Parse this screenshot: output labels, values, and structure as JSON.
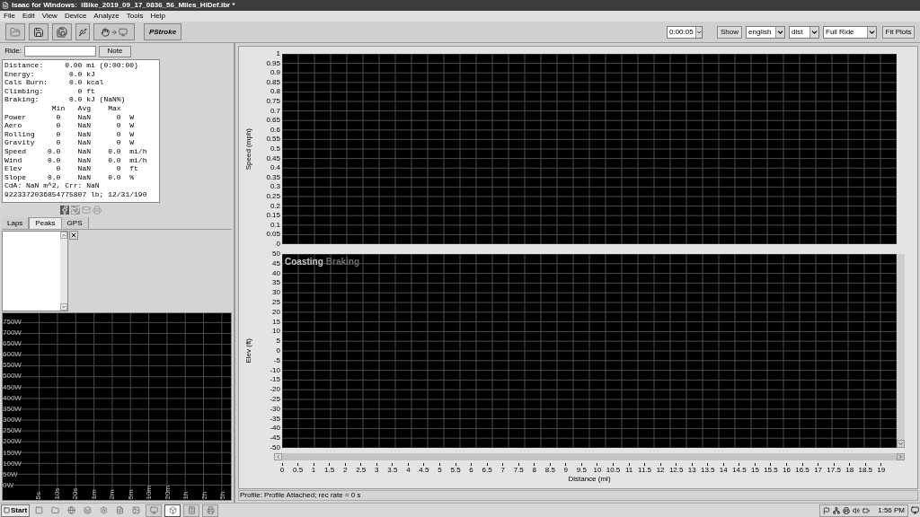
{
  "window": {
    "title": "Isaac for Windows:  iBike_2019_09_17_0836_56_Miles_HiDef.ibr *"
  },
  "menu": [
    "File",
    "Edit",
    "View",
    "Device",
    "Analyze",
    "Tools",
    "Help"
  ],
  "toolbar": {
    "logo": "PStroke",
    "interval": "0:00:05",
    "show_button": "Show",
    "units": "english",
    "axis": "dist",
    "range": "Full Ride",
    "fit_button": "Fit Plots"
  },
  "ride": {
    "label": "Ride:",
    "note_button": "Note"
  },
  "summary_lines": [
    "Distance:     0.00 mi (0:00:00)",
    "Energy:        0.0 kJ",
    "Cals Burn:     0.0 kcal",
    "Climbing:        0 ft",
    "Braking:       0.0 kJ (NaN%)",
    "           Min   Avg    Max",
    "Power       0    NaN      0  W",
    "Aero        0    NaN      0  W",
    "Rolling     0    NaN      0  W",
    "Gravity     0    NaN      0  W",
    "Speed     0.0    NaN    0.0  mi/h",
    "Wind      0.0    NaN    0.0  mi/h",
    "Elev        0    NaN      0  ft",
    "Slope     0.0    NaN    0.0  %",
    "CdA: NaN m^2, Crr: NaN",
    "9223372036854775807 lb; 12/31/190"
  ],
  "tabs": [
    {
      "label": "Laps",
      "selected": false
    },
    {
      "label": "Peaks",
      "selected": true
    },
    {
      "label": "GPS",
      "selected": false
    }
  ],
  "power_chart": {
    "y_labels": [
      "750W",
      "700W",
      "650W",
      "600W",
      "550W",
      "500W",
      "450W",
      "400W",
      "350W",
      "300W",
      "250W",
      "200W",
      "150W",
      "100W",
      "50W",
      "0W"
    ],
    "x_labels": [
      "5s",
      "10s",
      "20s",
      "1m",
      "2m",
      "5m",
      "10m",
      "20m",
      "1h",
      "2h",
      "5h"
    ]
  },
  "speed_chart": {
    "ylabel": "Speed (mph)",
    "y_labels": [
      "1",
      "0.95",
      "0.9",
      "0.85",
      "0.8",
      "0.75",
      "0.7",
      "0.65",
      "0.6",
      "0.55",
      "0.5",
      "0.45",
      "0.4",
      "0.35",
      "0.3",
      "0.25",
      "0.2",
      "0.15",
      "0.1",
      "0.05",
      "0"
    ]
  },
  "elev_chart": {
    "ylabel": "Elev (ft)",
    "legend": [
      {
        "label": "Coasting",
        "color": "#c8c8c8"
      },
      {
        "label": "Braking",
        "color": "#6a6a6a"
      }
    ],
    "y_labels": [
      "50",
      "45",
      "40",
      "35",
      "30",
      "25",
      "20",
      "15",
      "10",
      "5",
      "0",
      "-5",
      "-10",
      "-15",
      "-20",
      "-25",
      "-30",
      "-35",
      "-40",
      "-45",
      "-50"
    ]
  },
  "x_axis": {
    "label": "Distance (mi)",
    "ticks": [
      "0",
      "0.5",
      "1",
      "1.5",
      "2",
      "2.5",
      "3",
      "3.5",
      "4",
      "4.5",
      "5",
      "5.5",
      "6",
      "6.5",
      "7",
      "7.5",
      "8",
      "8.5",
      "9",
      "9.5",
      "10",
      "10.5",
      "11",
      "11.5",
      "12",
      "12.5",
      "13",
      "13.5",
      "14",
      "14.5",
      "15",
      "15.5",
      "16",
      "16.5",
      "17",
      "17.5",
      "18",
      "18.5",
      "19"
    ]
  },
  "status_bar": "Profile: Profile Attached; rec rate = 0 s",
  "taskbar": {
    "start": "Start",
    "clock": "1:56 PM",
    "items": [
      {
        "kind": "launcher",
        "selected": false
      },
      {
        "kind": "launcher",
        "selected": false
      },
      {
        "kind": "launcher",
        "selected": false
      },
      {
        "kind": "launcher",
        "selected": false
      },
      {
        "kind": "launcher",
        "selected": false
      },
      {
        "kind": "launcher",
        "selected": false
      },
      {
        "kind": "launcher",
        "selected": false
      },
      {
        "kind": "window",
        "selected": false
      },
      {
        "kind": "window",
        "selected": true
      },
      {
        "kind": "window",
        "selected": false
      },
      {
        "kind": "window",
        "selected": false
      }
    ]
  }
}
